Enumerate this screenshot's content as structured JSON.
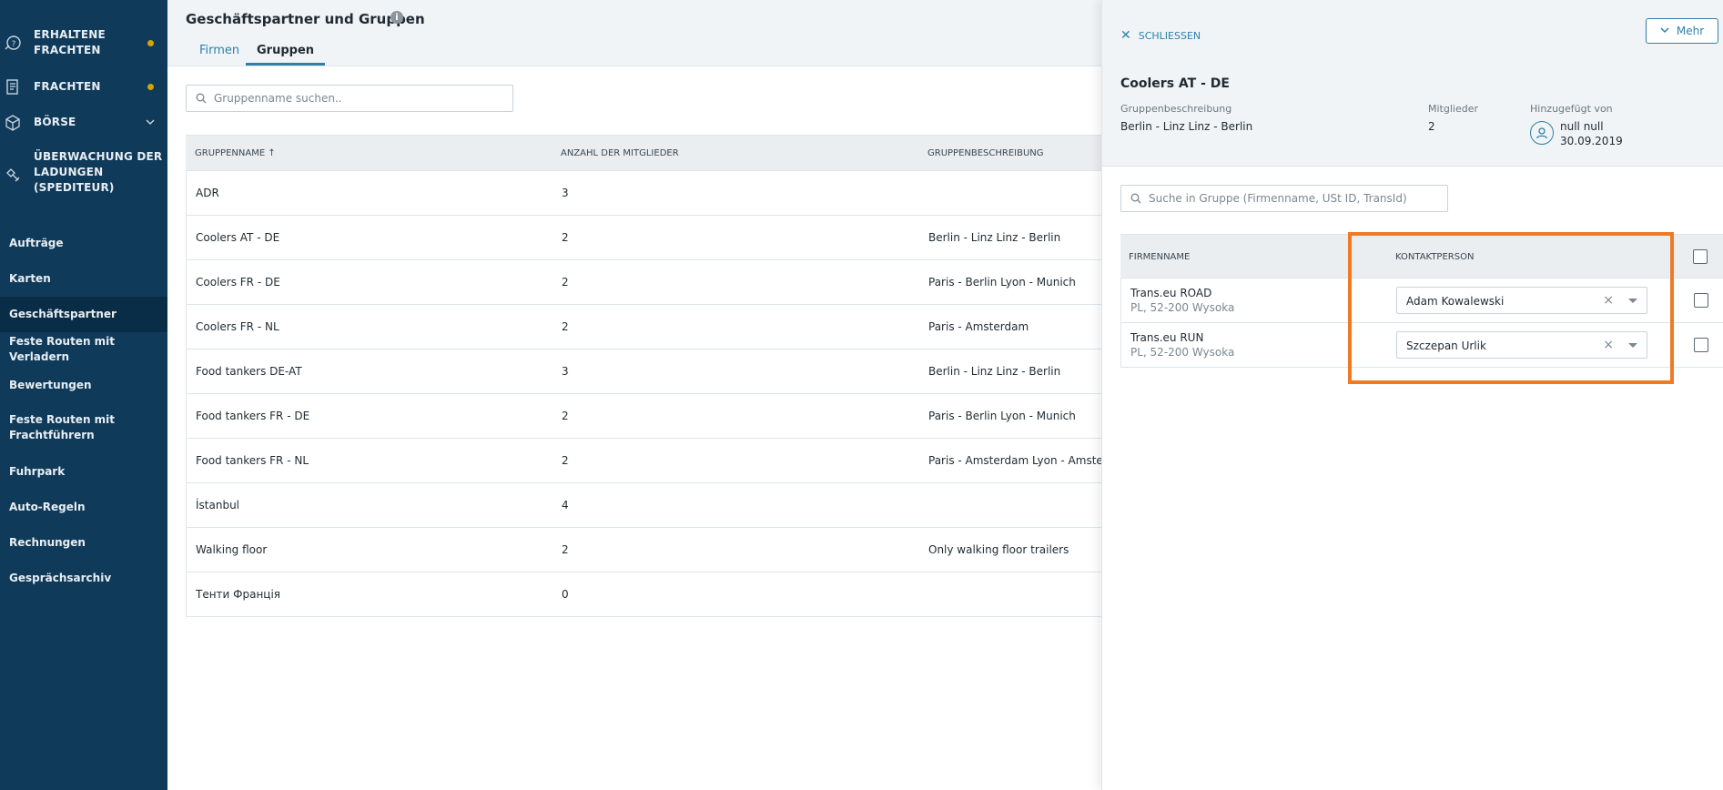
{
  "sidebar": {
    "top_items": [
      {
        "label_line1": "ERHALTENE",
        "label_line2": "FRACHTEN",
        "icon": "received-freight-icon",
        "has_dot": true
      },
      {
        "label_line1": "FRACHTEN",
        "label_line2": "",
        "icon": "freight-list-icon",
        "has_dot": true
      },
      {
        "label_line1": "BÖRSE",
        "label_line2": "",
        "icon": "exchange-box-icon",
        "has_dot": false,
        "has_chevron": true
      },
      {
        "label_line1": "ÜBERWACHUNG DER",
        "label_line2": "LADUNGEN",
        "label_line3": "(SPEDITEUR)",
        "icon": "monitoring-satellite-icon",
        "has_dot": false
      }
    ],
    "items": [
      {
        "label": "Aufträge"
      },
      {
        "label": "Karten"
      },
      {
        "label": "Geschäftspartner",
        "active": true
      },
      {
        "label": "Feste Routen mit Verladern"
      },
      {
        "label": "Bewertungen"
      },
      {
        "label_line1": "Feste Routen mit",
        "label_line2": "Frachtführern"
      },
      {
        "label": "Fuhrpark"
      },
      {
        "label": "Auto-Regeln"
      },
      {
        "label": "Rechnungen"
      },
      {
        "label": "Gesprächsarchiv"
      }
    ]
  },
  "header": {
    "title": "Geschäftspartner und Gruppen",
    "tabs": [
      {
        "label": "Firmen"
      },
      {
        "label": "Gruppen",
        "active": true
      }
    ]
  },
  "search": {
    "placeholder": "Gruppenname suchen.."
  },
  "table": {
    "columns": [
      "GRUPPENNAME ↑",
      "ANZAHL DER MITGLIEDER",
      "GRUPPENBESCHREIBUNG"
    ],
    "rows": [
      {
        "name": "ADR",
        "members": "3",
        "description": ""
      },
      {
        "name": "Coolers AT - DE",
        "members": "2",
        "description": "Berlin - Linz Linz - Berlin"
      },
      {
        "name": "Coolers FR - DE",
        "members": "2",
        "description": "Paris - Berlin Lyon - Munich"
      },
      {
        "name": "Coolers FR - NL",
        "members": "2",
        "description": "Paris - Amsterdam"
      },
      {
        "name": "Food tankers DE-AT",
        "members": "3",
        "description": "Berlin - Linz Linz - Berlin"
      },
      {
        "name": "Food tankers FR - DE",
        "members": "2",
        "description": "Paris - Berlin Lyon - Munich"
      },
      {
        "name": "Food tankers FR - NL",
        "members": "2",
        "description": "Paris - Amsterdam Lyon - Amsterda"
      },
      {
        "name": "İstanbul",
        "members": "4",
        "description": ""
      },
      {
        "name": "Walking floor",
        "members": "2",
        "description": "Only walking floor trailers"
      },
      {
        "name": "Тенти Франція",
        "members": "0",
        "description": ""
      }
    ]
  },
  "panel": {
    "close_label": "SCHLIESSEN",
    "more_label": "Mehr",
    "group_title": "Coolers AT - DE",
    "description_label": "Gruppenbeschreibung",
    "description_value": "Berlin - Linz Linz - Berlin",
    "members_label": "Mitglieder",
    "members_value": "2",
    "added_by_label": "Hinzugefügt von",
    "added_by_name": "null null",
    "added_by_date": "30.09.2019",
    "search_placeholder": "Suche in Gruppe (Firmenname, USt ID, TransId)",
    "columns": [
      "FIRMENNAME",
      "KONTAKTPERSON"
    ],
    "rows": [
      {
        "company": "Trans.eu ROAD",
        "address": "PL, 52-200 Wysoka",
        "contact": "Adam Kowalewski"
      },
      {
        "company": "Trans.eu RUN",
        "address": "PL, 52-200 Wysoka",
        "contact": "Szczepan Urlik"
      }
    ]
  },
  "colors": {
    "sidebar_bg": "#0f3a5a",
    "accent": "#2f80a8",
    "notification_dot": "#d5a300",
    "highlight": "#f07a22"
  }
}
